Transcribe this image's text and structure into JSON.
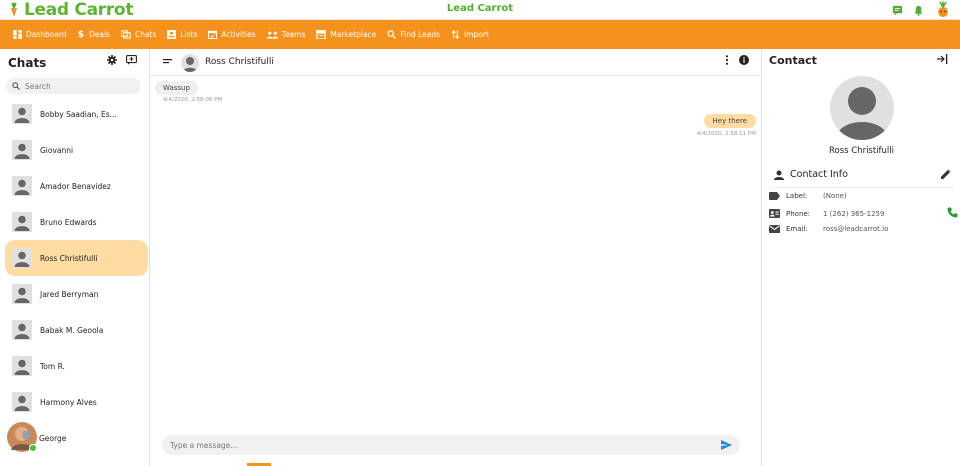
{
  "app": {
    "logo_text": "Lead Carrot",
    "title": "Lead Carrot"
  },
  "colors": {
    "brand_orange": "#f5921e",
    "brand_green": "#4caf2e",
    "active_chat": "#fddba1"
  },
  "nav": [
    {
      "label": "Dashboard",
      "icon": "dashboard-icon"
    },
    {
      "label": "Deals",
      "icon": "dollar-icon"
    },
    {
      "label": "Chats",
      "icon": "chat-icon"
    },
    {
      "label": "Lists",
      "icon": "list-icon"
    },
    {
      "label": "Activities",
      "icon": "calendar-icon"
    },
    {
      "label": "Teams",
      "icon": "team-icon"
    },
    {
      "label": "Marketplace",
      "icon": "store-icon"
    },
    {
      "label": "Find Leads",
      "icon": "search-icon"
    },
    {
      "label": "Import",
      "icon": "import-icon"
    }
  ],
  "chats": {
    "title": "Chats",
    "search_placeholder": "Search",
    "items": [
      {
        "name": "Bobby Saadian, Es..."
      },
      {
        "name": "Giovanni"
      },
      {
        "name": "Amador Benavidez"
      },
      {
        "name": "Bruno Edwards"
      },
      {
        "name": "Ross Christifulli"
      },
      {
        "name": "Jared Berryman"
      },
      {
        "name": "Babak M. Geoola"
      },
      {
        "name": "Tom R."
      },
      {
        "name": "Harmony Alves"
      },
      {
        "name": "George"
      }
    ]
  },
  "conversation": {
    "name": "Ross Christifulli",
    "messages": [
      {
        "text": "Wassup",
        "time": "4/4/2020, 2:58:06 PM",
        "direction": "in"
      },
      {
        "text": "Hey there",
        "time": "4/4/2020, 2:58:11 PM",
        "direction": "out"
      }
    ],
    "composer_placeholder": "Type a message..."
  },
  "contact": {
    "title": "Contact",
    "name": "Ross Christifulli",
    "info_title": "Contact Info",
    "label_key": "Label:",
    "label_val": "(None)",
    "phone_key": "Phone:",
    "phone_val": "1 (262) 365-1259",
    "email_key": "Email:",
    "email_val": "ross@leadcarrot.io"
  }
}
